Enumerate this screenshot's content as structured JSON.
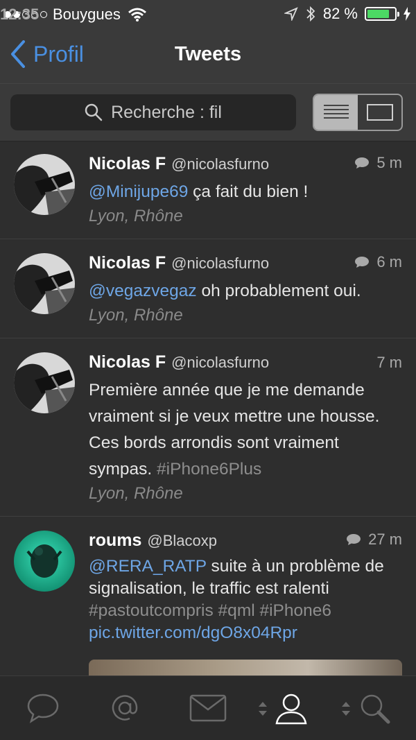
{
  "status_bar": {
    "carrier": "Bouygues",
    "time": "12:35",
    "battery": "82 %",
    "signal_dots_filled": 2,
    "signal_dots_total": 5,
    "battery_level": 0.82,
    "battery_color": "#4cd964"
  },
  "nav": {
    "back_label": "Profil",
    "title": "Tweets"
  },
  "search": {
    "placeholder": "Recherche : fil",
    "view_toggle_active": "list"
  },
  "tweets": [
    {
      "name": "Nicolas F",
      "handle": "@nicolasfurno",
      "time": "5 m",
      "has_reply_icon": true,
      "text_parts": [
        {
          "type": "mention",
          "text": "@Minijupe69"
        },
        {
          "type": "plain",
          "text": " ça fait du bien !"
        }
      ],
      "location": "Lyon, Rhône"
    },
    {
      "name": "Nicolas F",
      "handle": "@nicolasfurno",
      "time": "6 m",
      "has_reply_icon": true,
      "text_parts": [
        {
          "type": "mention",
          "text": "@vegazvegaz"
        },
        {
          "type": "plain",
          "text": " oh probablement oui."
        }
      ],
      "location": "Lyon, Rhône"
    },
    {
      "name": "Nicolas F",
      "handle": "@nicolasfurno",
      "time": "7 m",
      "has_reply_icon": false,
      "text_parts": [
        {
          "type": "plain",
          "text": "Première année que je me demande vraiment si je veux mettre une housse. Ces bords arrondis sont vraiment sympas. "
        },
        {
          "type": "tag",
          "text": "#iPhone6Plus"
        }
      ],
      "location": "Lyon, Rhône"
    },
    {
      "name": "roums",
      "handle": "@Blacoxp",
      "time": "27 m",
      "has_reply_icon": true,
      "text_parts": [
        {
          "type": "mention",
          "text": "@RERA_RATP"
        },
        {
          "type": "plain",
          "text": " suite à un problème de signalisation, le traffic est ralenti "
        },
        {
          "type": "tag",
          "text": "#pastoutcompris #qml #iPhone6"
        },
        {
          "type": "plain",
          "text": " "
        },
        {
          "type": "link",
          "text": "pic.twitter.com/dgO8x04Rpr"
        }
      ],
      "location": ""
    }
  ],
  "tabbar": {
    "items": [
      "speech-bubble-icon",
      "at-icon",
      "envelope-icon",
      "profile-icon",
      "search-icon"
    ],
    "active": "profile-icon"
  },
  "colors": {
    "accent": "#4a90e2",
    "mention": "#6ea6e6",
    "hashtag": "#8e8e8e",
    "background": "#2e2e2e",
    "bar": "#3a3a3a"
  }
}
